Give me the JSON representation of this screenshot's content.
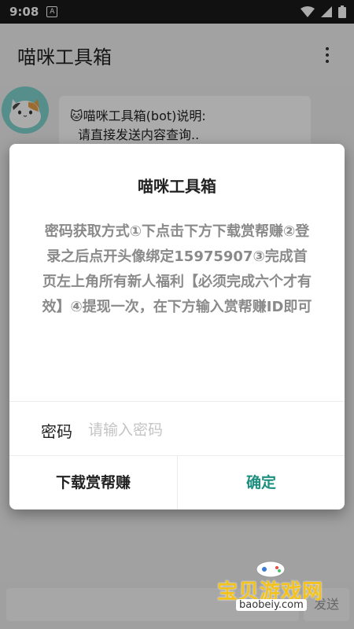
{
  "status_bar": {
    "time": "9:08",
    "notification_glyph": "A"
  },
  "app_bar": {
    "title": "喵咪工具箱"
  },
  "chat": {
    "bubble_line1": "🐱喵咪工具箱(bot)说明:",
    "bubble_line2": "请直接发送内容查询.."
  },
  "bottom_bar": {
    "send_label": "发送"
  },
  "dialog": {
    "title": "喵咪工具箱",
    "message": "密码获取方式①下点击下方下载赏帮赚②登录之后点开头像绑定15975907③完成首页左上角所有新人福利【必须完成六个才有效】④提现一次，在下方输入赏帮赚ID即可",
    "password_label": "密码",
    "password_placeholder": "请输入密码",
    "password_value": "",
    "negative_button": "下载赏帮赚",
    "positive_button": "确定"
  },
  "watermark": {
    "text": "宝贝游戏网",
    "url": "baobeiy.com"
  },
  "colors": {
    "accent": "#1d8f7e",
    "status_bar": "#1a1a1a",
    "scrim": "rgba(0,0,0,0.33)"
  },
  "icons": [
    "wifi-icon",
    "signal-icon",
    "battery-icon",
    "more-vert-icon",
    "cat-avatar-icon"
  ]
}
